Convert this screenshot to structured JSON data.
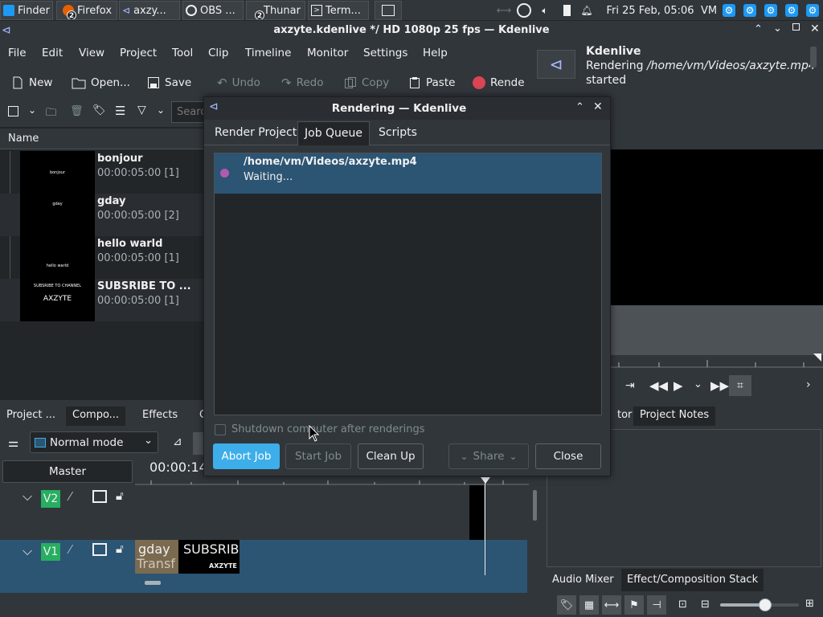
{
  "taskbar": {
    "tasks": [
      {
        "label": "Finder"
      },
      {
        "label": "Firefox",
        "badge": "2"
      },
      {
        "label": "axzy..."
      },
      {
        "label": "OBS ..."
      },
      {
        "label": "Thunar",
        "badge": "2"
      },
      {
        "label": "Term..."
      }
    ],
    "clock": "Fri 25 Feb, 05:06",
    "user": "VM"
  },
  "window": {
    "title": "axzyte.kdenlive */ HD 1080p 25 fps — Kdenlive"
  },
  "menu": [
    "File",
    "Edit",
    "View",
    "Project",
    "Tool",
    "Clip",
    "Timeline",
    "Monitor",
    "Settings",
    "Help"
  ],
  "toolbar": {
    "new": "New",
    "open": "Open...",
    "save": "Save",
    "undo": "Undo",
    "redo": "Redo",
    "copy": "Copy",
    "paste": "Paste",
    "render": "Rende"
  },
  "notification": {
    "app": "Kdenlive",
    "line1_prefix": "Rendering ",
    "line1_path": "/home/vm/Videos/axzyte.mp4",
    "line2": "started"
  },
  "bin": {
    "search_placeholder": "Searc",
    "column": "Name",
    "clips": [
      {
        "name": "bonjour",
        "duration": "00:00:05:00 [1]",
        "thumb_text": "bonjour"
      },
      {
        "name": "gday",
        "duration": "00:00:05:00 [2]",
        "thumb_text": "gday"
      },
      {
        "name": "hello warld",
        "duration": "00:00:05:00 [1]",
        "thumb_text": "hello warld"
      },
      {
        "name": "SUBSRIBE TO ...",
        "duration": "00:00:05:00 [1]",
        "thumb_text": "SUBSRIBE TO CHANNEL",
        "thumb_sub": "AXZYTE"
      }
    ]
  },
  "left_tabs": [
    "Project ...",
    "Compo...",
    "Effects",
    "C"
  ],
  "timeline": {
    "mode": "Normal mode",
    "master": "Master",
    "timecode": "00:00:14",
    "tracks": [
      {
        "label": "V2"
      },
      {
        "label": "V1"
      }
    ],
    "v1_clips": [
      {
        "name": "gday",
        "sub": "Transf"
      },
      {
        "name": "SUBSRIB",
        "sub": "AXZYTE"
      }
    ]
  },
  "right_tabs": [
    "tor",
    "Project Notes"
  ],
  "bottom_tabs": [
    "Audio Mixer",
    "Effect/Composition Stack"
  ],
  "dialog": {
    "title": "Rendering — Kdenlive",
    "tabs": [
      "Render Project",
      "Job Queue",
      "Scripts"
    ],
    "job": {
      "path": "/home/vm/Videos/axzyte.mp4",
      "status": "Waiting..."
    },
    "shutdown_label": "Shutdown computer after renderings",
    "shutdown_checked": false,
    "buttons": {
      "abort": "Abort Job",
      "start": "Start Job",
      "cleanup": "Clean Up",
      "share": "Share",
      "close": "Close"
    }
  },
  "colors": {
    "accent": "#3daee9",
    "selection": "#2c5473",
    "track_label": "#27ae60",
    "record": "#da4453"
  }
}
